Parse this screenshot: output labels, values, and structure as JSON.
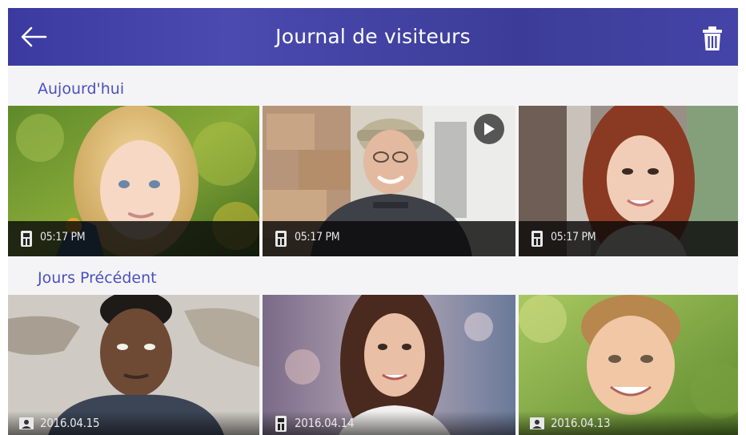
{
  "header": {
    "title": "Journal de visiteurs",
    "back_icon": "arrow-left-icon",
    "delete_icon": "trash-icon"
  },
  "sections": {
    "today": {
      "label": "Aujourd'hui",
      "items": [
        {
          "time": "05:17 PM",
          "source_icon": "door-station-icon",
          "has_video": false,
          "subject": "blonde child in garden"
        },
        {
          "time": "05:17 PM",
          "source_icon": "door-station-icon",
          "has_video": true,
          "subject": "delivery man with cap"
        },
        {
          "time": "05:17 PM",
          "source_icon": "door-station-icon",
          "has_video": false,
          "subject": "woman with red-brown hair"
        }
      ]
    },
    "previous": {
      "label": "Jours Précédent",
      "items": [
        {
          "date": "2016.04.15",
          "source_icon": "photo-icon",
          "subject": "young man against wall"
        },
        {
          "date": "2016.04.14",
          "source_icon": "door-station-icon",
          "subject": "smiling woman with long hair"
        },
        {
          "date": "2016.04.13",
          "source_icon": "photo-icon",
          "subject": "smiling boy outdoors"
        }
      ]
    }
  },
  "colors": {
    "header_gradient": [
      "#3a3aa0",
      "#4a4ab0"
    ],
    "section_label": "#4d4fc0",
    "background": "#f4f4f6"
  }
}
